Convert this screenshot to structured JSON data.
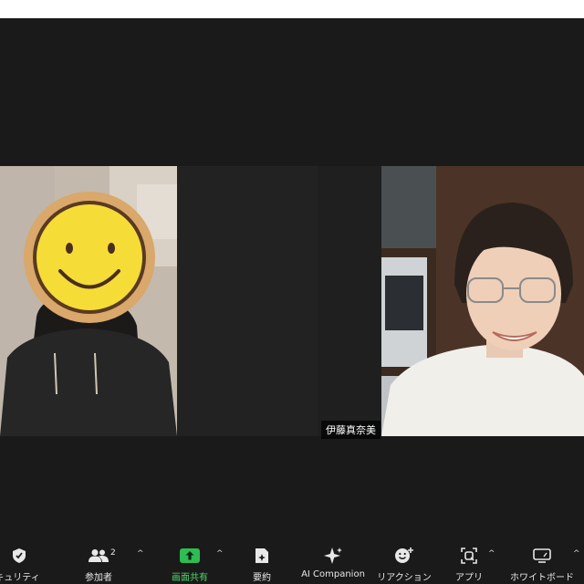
{
  "participants": {
    "right_name": "伊藤真奈美"
  },
  "toolbar": {
    "security_label": "キュリティ",
    "participants_label": "参加者",
    "participants_count": "2",
    "share_label": "画面共有",
    "summary_label": "要約",
    "ai_label": "AI Companion",
    "reaction_label": "リアクション",
    "apps_label": "アプリ",
    "whiteboard_label": "ホワイトボード",
    "caret": "^"
  },
  "colors": {
    "share_accent": "#2dbd52",
    "toolbar_bg": "#1a1a1a"
  }
}
